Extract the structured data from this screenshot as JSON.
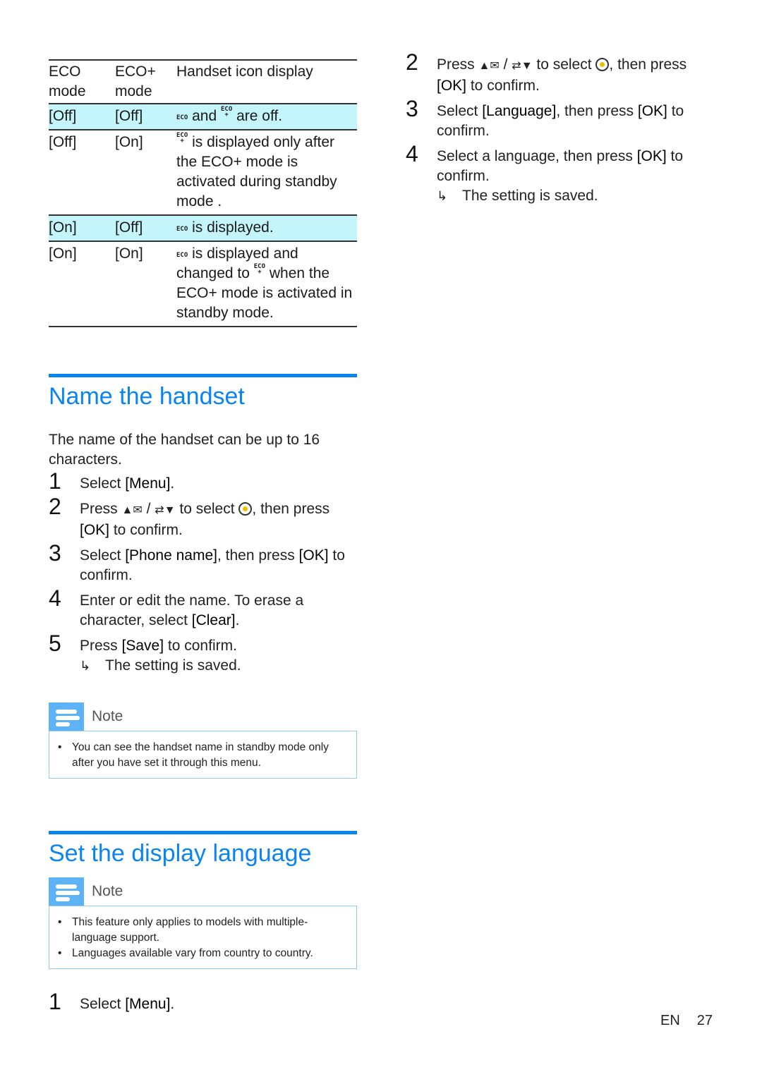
{
  "table": {
    "headers": [
      "ECO mode",
      "ECO+ mode",
      "Handset icon display"
    ],
    "header_lines": [
      [
        "ECO",
        "mode"
      ],
      [
        "ECO+",
        "mode"
      ],
      [
        "Handset icon display"
      ]
    ],
    "rows": [
      {
        "eco": "[Off]",
        "ecoplus": "[Off]",
        "highlight": true,
        "display_parts": [
          {
            "icon": "eco-icon"
          },
          {
            "text": " and "
          },
          {
            "icon": "eco-plus-icon"
          },
          {
            "text": " are off."
          }
        ]
      },
      {
        "eco": "[Off]",
        "ecoplus": "[On]",
        "highlight": false,
        "display_parts": [
          {
            "icon": "eco-plus-icon"
          },
          {
            "text": " is displayed only after the ECO+ mode is activated during standby mode ."
          }
        ]
      },
      {
        "eco": "[On]",
        "ecoplus": "[Off]",
        "highlight": true,
        "display_parts": [
          {
            "icon": "eco-icon"
          },
          {
            "text": " is displayed."
          }
        ]
      },
      {
        "eco": "[On]",
        "ecoplus": "[On]",
        "highlight": false,
        "display_parts": [
          {
            "icon": "eco-icon"
          },
          {
            "text": " is displayed and changed to "
          },
          {
            "icon": "eco-plus-icon"
          },
          {
            "text": " when the ECO+ mode is activated in standby mode."
          }
        ]
      }
    ],
    "icon_text": {
      "eco": "ECO",
      "plus": "+"
    },
    "highlight_color": "#c3f5fa"
  },
  "name_section": {
    "title": "Name the handset",
    "intro": "The name of the handset can be up to 16 characters.",
    "steps": [
      {
        "num": "1",
        "pre": "Select ",
        "bold": "[Menu]",
        "post": "."
      },
      {
        "num": "2",
        "pre": "Press ",
        "icons": [
          "up-contacts-icon",
          "down-redial-icon",
          "settings-icon"
        ],
        "after_select": ", then press ",
        "bold": "[OK]",
        "post": " to confirm.",
        "sep": " / ",
        "mid": " to select "
      },
      {
        "num": "3",
        "pre": "Select ",
        "bold": "[Phone name]",
        "mid2": ", then press ",
        "bold2": "[OK]",
        "post": " to confirm."
      },
      {
        "num": "4",
        "pre": "Enter or edit the name. To erase a character, select ",
        "bold": "[Clear]",
        "post": "."
      },
      {
        "num": "5",
        "pre": "Press ",
        "bold": "[Save]",
        "post": " to confirm."
      }
    ],
    "result": "The setting is saved.",
    "note": {
      "title": "Note",
      "items": [
        "You can see the handset name in standby mode only after you have set it through this menu."
      ]
    }
  },
  "language_section": {
    "title": "Set the display language",
    "note": {
      "title": "Note",
      "items": [
        "This feature only applies to models with multiple-language support.",
        "Languages available vary from country to country."
      ]
    },
    "steps": [
      {
        "num": "1",
        "pre": "Select ",
        "bold": "[Menu]",
        "post": "."
      },
      {
        "num": "2",
        "pre": "Press ",
        "sep": " / ",
        "mid": " to select ",
        "after_select": ", then press ",
        "bold": "[OK]",
        "post": " to confirm."
      },
      {
        "num": "3",
        "pre": "Select ",
        "bold": "[Language]",
        "mid2": ", then press ",
        "bold2": "[OK]",
        "post": " to confirm."
      },
      {
        "num": "4",
        "pre": "Select a language, then press ",
        "bold": "[OK]",
        "post": " to confirm."
      }
    ],
    "result": "The setting is saved."
  },
  "footer": {
    "lang": "EN",
    "page": "27"
  },
  "colors": {
    "accent": "#0a84f0",
    "note_icon": "#5eb3f7",
    "note_border": "#8fcaf5"
  }
}
